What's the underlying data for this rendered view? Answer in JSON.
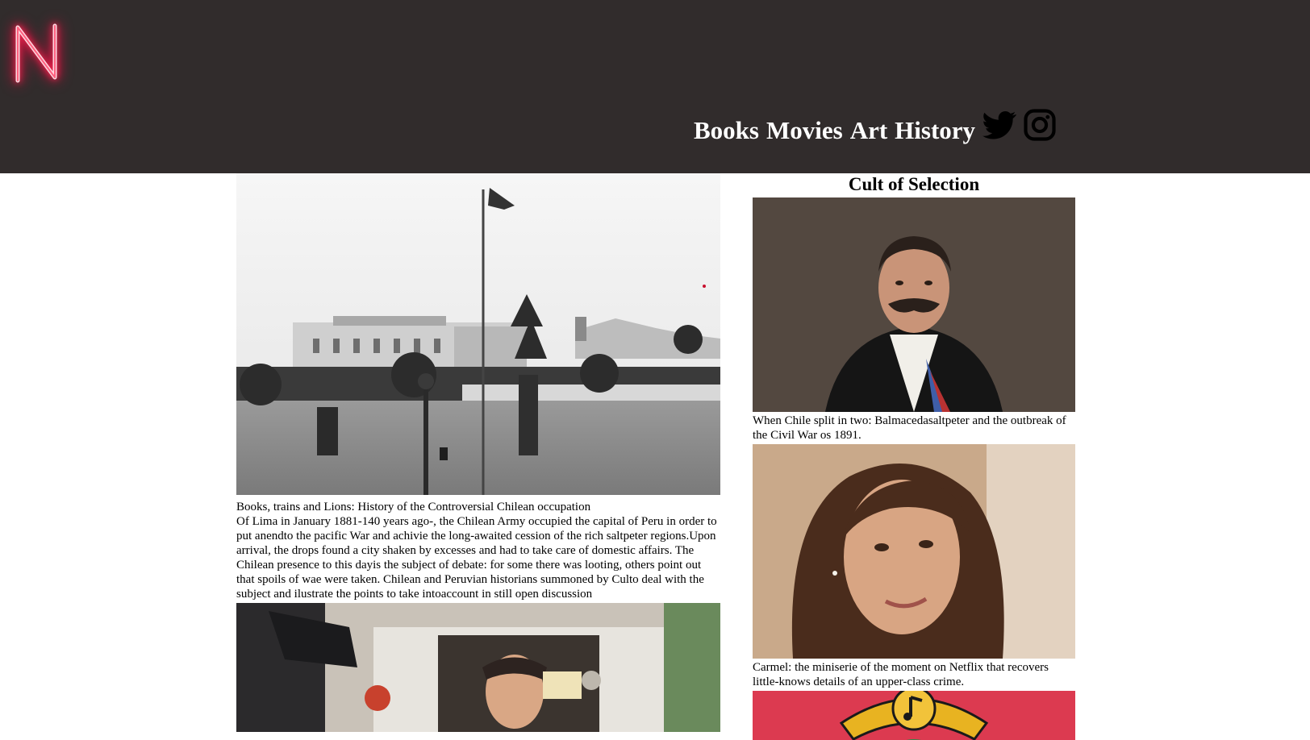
{
  "header": {
    "logo_letter": "N",
    "nav": [
      {
        "label": "Books"
      },
      {
        "label": "Movies"
      },
      {
        "label": "Art"
      },
      {
        "label": "History"
      }
    ],
    "social": [
      {
        "icon": "twitter-icon"
      },
      {
        "icon": "instagram-icon"
      }
    ]
  },
  "main": {
    "article_title": "Books, trains and Lions: History of the Controversial Chilean occupation",
    "article_body": "Of Lima in January 1881-140 years ago-, the Chilean Army occupied the capital of Peru in order to put anendto the pacific War and achivie the long-awaited cession of the rich saltpeter regions.Upon arrival, the drops found a city shaken by excesses and had to take care of domestic affairs. The Chilean presence to this dayis the subject of debate: for some there was looting, others point out that spoils of wae were taken. Chilean and Peruvian historians summoned by Culto deal with the subject and ilustrate the points to take intoaccount in still open discussion"
  },
  "sidebar": {
    "heading": "Cult of Selection",
    "items": [
      {
        "caption": "When Chile split in two: Balmacedasaltpeter and the outbreak of the Civil War os 1891."
      },
      {
        "caption": "Carmel: the miniserie of the moment on Netflix that recovers little-knows details of an upper-class crime."
      }
    ]
  },
  "colors": {
    "header_bg": "#312c2c",
    "logo_neon": "#ff2d55",
    "nav_text": "#ffffff",
    "banner_red": "#dc3a50"
  }
}
